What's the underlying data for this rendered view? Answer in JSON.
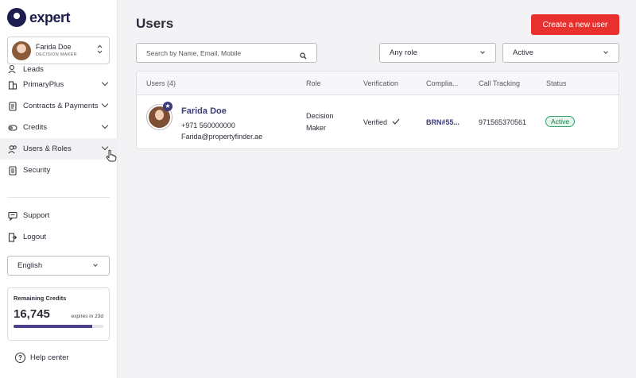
{
  "brand": {
    "name": "expert",
    "color": "#1d1d4f"
  },
  "current_user": {
    "name": "Farida Doe",
    "role": "DECISION MAKER"
  },
  "nav": {
    "items": [
      {
        "label": "Leads",
        "icon": "leads-icon",
        "has_chevron": false
      },
      {
        "label": "PrimaryPlus",
        "icon": "building-icon",
        "has_chevron": true
      },
      {
        "label": "Contracts & Payments",
        "icon": "document-icon",
        "has_chevron": true
      },
      {
        "label": "Credits",
        "icon": "coins-icon",
        "has_chevron": true
      },
      {
        "label": "Users & Roles",
        "icon": "users-icon",
        "has_chevron": true,
        "active": true
      },
      {
        "label": "Security",
        "icon": "security-document-icon",
        "has_chevron": false
      }
    ],
    "secondary": [
      {
        "label": "Support",
        "icon": "chat-icon"
      },
      {
        "label": "Logout",
        "icon": "logout-icon"
      }
    ]
  },
  "language": {
    "selected": "English"
  },
  "credits": {
    "title": "Remaining Credits",
    "value": "16,745",
    "expires": "expires in 23d",
    "progress": 0.88,
    "bar_color": "#4c3f8f"
  },
  "help": {
    "label": "Help center",
    "glyph": "?"
  },
  "page": {
    "title": "Users",
    "create_button": "Create a new user",
    "accent": "#e8312f",
    "search_placeholder": "Search by Name, Email, Mobile",
    "role_filter": "Any role",
    "status_filter": "Active"
  },
  "table": {
    "headers": {
      "users": "Users (4)",
      "role": "Role",
      "verification": "Verification",
      "compliance": "Complia...",
      "call_tracking": "Call Tracking",
      "status": "Status"
    },
    "rows": [
      {
        "name": "Farida Doe",
        "phone": "+971 560000000",
        "email": "Farida@propertyfinder.ae",
        "role_line1": "Decision",
        "role_line2": "Maker",
        "verification": "Verified",
        "compliance": "BRN#55...",
        "call_tracking": "971565370561",
        "status": "Active",
        "status_color": "#36a06a"
      }
    ]
  }
}
